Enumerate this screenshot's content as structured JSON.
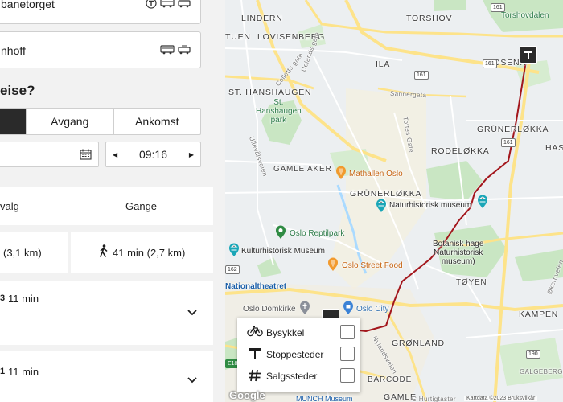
{
  "panel": {
    "from": {
      "text": "banetorget",
      "icons": [
        "t-bane-icon",
        "bus-icon",
        "tram-icon"
      ]
    },
    "to": {
      "text": "nhoff",
      "icons": [
        "bus-icon",
        "tram-icon"
      ]
    },
    "question": "eise?",
    "time_mode": {
      "options": [
        "Avgang",
        "Ankomst"
      ]
    },
    "time_value": "09:16",
    "modes": {
      "left": "valg",
      "right": "Gange"
    },
    "summary": {
      "left": "(3,1 km)",
      "right": "41 min (2,7 km)"
    },
    "routes": [
      {
        "mark": "3",
        "time": "11 min"
      },
      {
        "mark": "1",
        "time": "11 min"
      }
    ]
  },
  "map": {
    "districts": {
      "lindern": "LINDERN",
      "torshov": "TORSHOV",
      "torshovdalen": "Torshovdalen",
      "tuen": "TUEN",
      "lovisenberg": "LOVISENBERG",
      "rosenh": "ROSENH",
      "ila": "ILA",
      "st_hanshaugen": "ST. HANSHAUGEN",
      "st_hanshaugen_park": "St.\nHanshaugen\npark",
      "grunerlokka_ne": "GRÜNERLØKKA",
      "has": "HAS",
      "rodelokka": "RODELØKKA",
      "gamle_aker": "GAMLE AKER",
      "grunerlokka": "GRÜNERLØKKA",
      "toyen": "TØYEN",
      "kampen": "KAMPEN",
      "gronland": "GRØNLAND",
      "barcode": "BARCODE",
      "gamle": "GAMLE",
      "galgeberg": "GALGEBERG"
    },
    "streets": {
      "uelands": "Uelands gate",
      "colletts": "Colletts gate",
      "sannergata": "Sannergata",
      "tofte": "Toftes Gate",
      "ullevalsveien": "Ullevålsveien",
      "okernveien": "Økernveien",
      "nylandsveien": "Nylandsveien",
      "c_hurtigtaster": "C Hurtigtaster"
    },
    "pois": {
      "mathallen": "Mathallen Oslo",
      "naturhistorisk": "Naturhistorisk museum",
      "reptilpark": "Oslo Reptilpark",
      "botanisk": "Botanisk hage\nNaturhistorisk\nmuseum)",
      "kulturhistorisk": "Kulturhistorisk Museum",
      "streetfood": "Oslo Street Food",
      "nationaltheatret": "Nationaltheatret",
      "domkirke": "Oslo Domkirke",
      "oslo_city": "Oslo City",
      "munch": "MUNCH Museum"
    },
    "shields": {
      "r161a": "161",
      "r161b": "161",
      "r161c": "161",
      "r161d": "161",
      "r162": "162",
      "e18": "E18",
      "r190": "190"
    },
    "legend": [
      {
        "label": "Bysykkel",
        "icon": "bicycle-icon",
        "checked": false
      },
      {
        "label": "Stoppesteder",
        "icon": "stop-sign-icon",
        "checked": false
      },
      {
        "label": "Salgssteder",
        "icon": "hash-icon",
        "checked": false
      }
    ],
    "google": "Google",
    "attribution": "Kartdata ©2023   Bruksvilkår"
  },
  "colors": {
    "route": "#a3161c",
    "park": "#c9e6c3",
    "water": "#aadaff",
    "road": "#fde38a"
  }
}
